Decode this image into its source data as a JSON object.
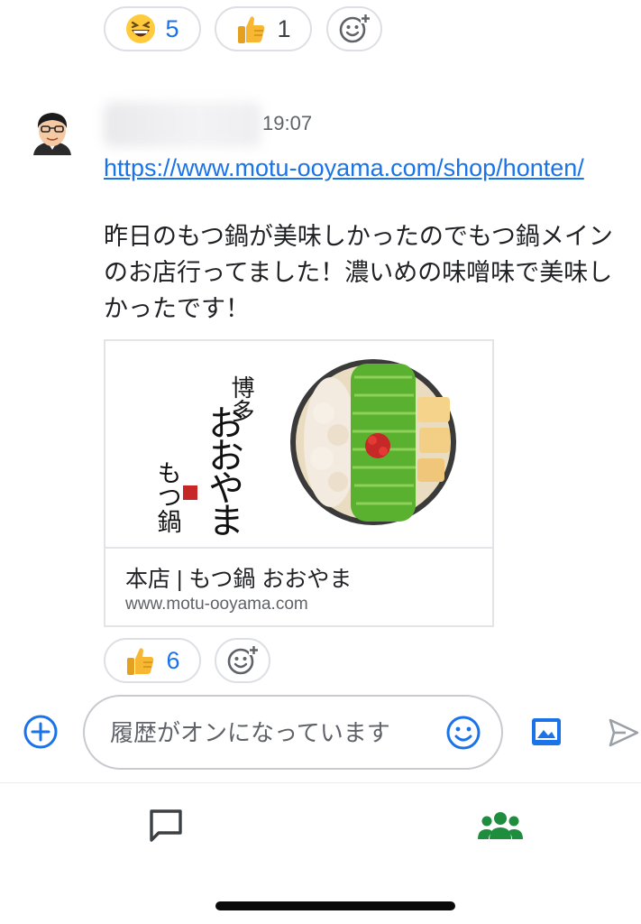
{
  "top_reactions": [
    {
      "emoji": "grinning-squinting-face",
      "count": "5"
    },
    {
      "emoji": "thumbs-up",
      "count": "1"
    }
  ],
  "message": {
    "sender_name": "",
    "time": "19:07",
    "link": "https://www.motu-ooyama.com/shop/honten/",
    "text": "昨日のもつ鍋が美味しかったのでもつ鍋メインのお店行ってました！濃いめの味噌味で美味しかったです！"
  },
  "preview": {
    "logo_text_1": "博多",
    "logo_text_2": "おおやま",
    "logo_text_3": "もつ鍋",
    "logo_seal": "大山",
    "title": "本店 | もつ鍋 おおやま",
    "domain": "www.motu-ooyama.com"
  },
  "bottom_reactions": [
    {
      "emoji": "thumbs-up",
      "count": "6"
    }
  ],
  "composer": {
    "placeholder": "履歴がオンになっています"
  },
  "colors": {
    "accent": "#1a73e8",
    "nav_active": "#1e8e3e",
    "nav_inactive": "#3c4043"
  }
}
